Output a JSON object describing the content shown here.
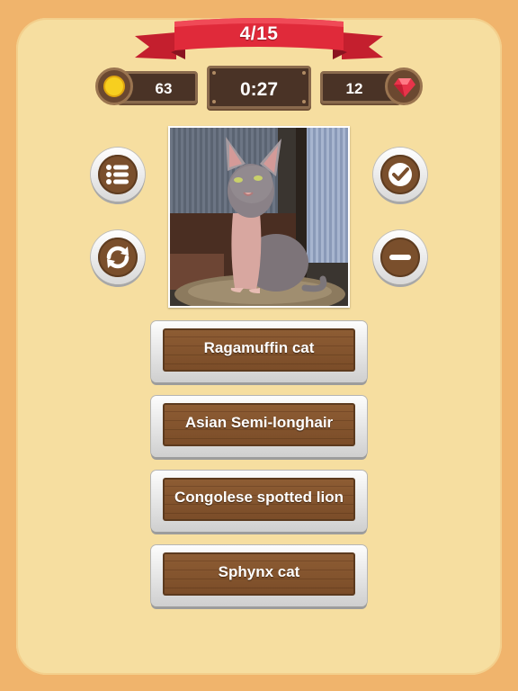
{
  "progress": {
    "label": "4/15"
  },
  "stats": {
    "coins": "63",
    "timer": "0:27",
    "gems": "12"
  },
  "answers": [
    {
      "label": "Ragamuffin cat"
    },
    {
      "label": "Asian Semi-longhair"
    },
    {
      "label": "Congolese spotted lion"
    },
    {
      "label": "Sphynx cat"
    }
  ],
  "icons": {
    "menu": "list-icon",
    "reset": "refresh-icon",
    "check": "check-icon",
    "remove": "minus-icon",
    "coin": "coin-icon",
    "gem": "gem-icon"
  },
  "colors": {
    "background": "#f0b46c",
    "panel": "#f6dea0",
    "ribbon": "#e02a3a",
    "wood": "#7a4c28",
    "plaque": "#4a3326"
  }
}
